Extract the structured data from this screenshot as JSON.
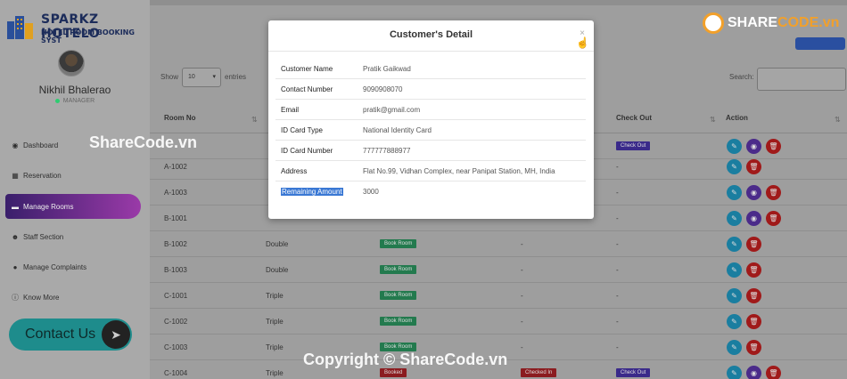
{
  "brand": {
    "title": "SPARKZ HOTELO",
    "subtitle": "HOTEL ROOM BOOKING SYST"
  },
  "user": {
    "name": "Nikhil Bhalerao",
    "role": "MANAGER"
  },
  "nav": [
    {
      "label": "Dashboard",
      "icon": "dashboard-icon"
    },
    {
      "label": "Reservation",
      "icon": "calendar-icon"
    },
    {
      "label": "Manage Rooms",
      "icon": "bed-icon"
    },
    {
      "label": "Staff Section",
      "icon": "users-icon"
    },
    {
      "label": "Manage Complaints",
      "icon": "comments-icon"
    },
    {
      "label": "Know More",
      "icon": "info-icon"
    }
  ],
  "contact_label": "Contact Us",
  "table_controls": {
    "show_label": "Show",
    "show_value": "10",
    "entries_label": "entries",
    "search_label": "Search:"
  },
  "columns": {
    "room_no": "Room No",
    "check_out": "Check Out",
    "action": "Action"
  },
  "rows": [
    {
      "room": "A-1002",
      "type": "",
      "status": "",
      "checkin": "",
      "checkout": "-"
    },
    {
      "room": "A-1003",
      "type": "",
      "status": "",
      "checkin": "",
      "checkout": "-"
    },
    {
      "room": "B-1001",
      "type": "",
      "status": "",
      "checkin": "",
      "checkout": "-"
    },
    {
      "room": "B-1002",
      "type": "Double",
      "status": "Book Room",
      "checkin": "-",
      "checkout": "-"
    },
    {
      "room": "B-1003",
      "type": "Double",
      "status": "Book Room",
      "checkin": "-",
      "checkout": "-"
    },
    {
      "room": "C-1001",
      "type": "Triple",
      "status": "Book Room",
      "checkin": "-",
      "checkout": "-"
    },
    {
      "room": "C-1002",
      "type": "Triple",
      "status": "Book Room",
      "checkin": "-",
      "checkout": "-"
    },
    {
      "room": "C-1003",
      "type": "Triple",
      "status": "Book Room",
      "checkin": "-",
      "checkout": "-"
    },
    {
      "room": "C-1004",
      "type": "Triple",
      "status": "Booked",
      "checkin": "Checked In",
      "checkout": "Check Out"
    }
  ],
  "first_row_checkout": "Check Out",
  "modal": {
    "title": "Customer's Detail",
    "close": "×",
    "fields": [
      {
        "label": "Customer Name",
        "value": "Pratik Gaikwad"
      },
      {
        "label": "Contact Number",
        "value": "9090908070"
      },
      {
        "label": "Email",
        "value": "pratik@gmail.com"
      },
      {
        "label": "ID Card Type",
        "value": "National Identity Card"
      },
      {
        "label": "ID Card Number",
        "value": "777777888977"
      },
      {
        "label": "Address",
        "value": "Flat No.99, Vidhan Complex, near Panipat Station, MH, India"
      },
      {
        "label": "Remaining Amount",
        "value": "3000"
      }
    ]
  },
  "watermarks": {
    "top_a": "SHARE",
    "top_b": "CODE.vn",
    "center": "ShareCode.vn",
    "bottom": "Copyright © ShareCode.vn"
  },
  "colors": {
    "accent": "#9a3aa8",
    "edit": "#1a7ea0",
    "view": "#4b2b8a",
    "delete": "#a01a1a",
    "book": "#237a4e"
  }
}
